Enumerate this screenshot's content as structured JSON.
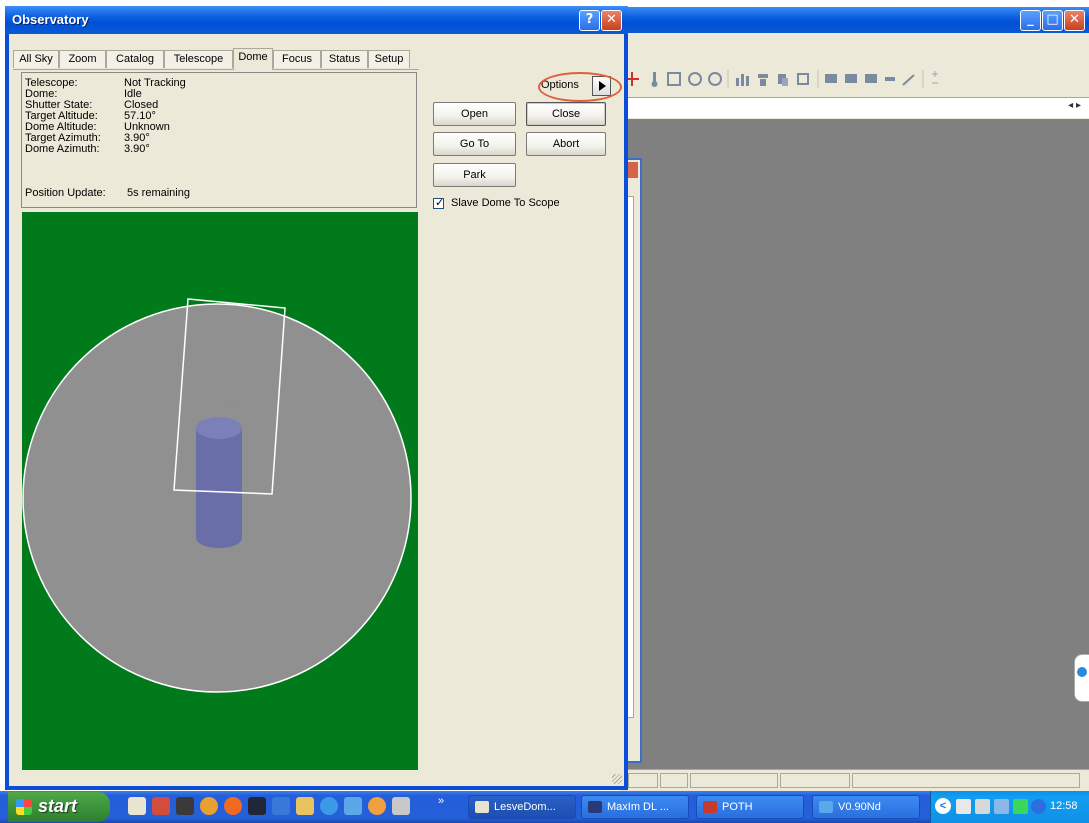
{
  "observatory": {
    "title": "Observatory",
    "help_glyph": "?",
    "close_glyph": "✕",
    "tabs": [
      {
        "label": "All Sky"
      },
      {
        "label": "Zoom"
      },
      {
        "label": "Catalog"
      },
      {
        "label": "Telescope"
      },
      {
        "label": "Dome",
        "active": true
      },
      {
        "label": "Focus"
      },
      {
        "label": "Status"
      },
      {
        "label": "Setup"
      }
    ],
    "info": [
      {
        "label": "Telescope:",
        "value": "Not Tracking"
      },
      {
        "label": "Dome:",
        "value": "Idle"
      },
      {
        "label": "Shutter State:",
        "value": "Closed"
      },
      {
        "label": "Target Altitude:",
        "value": "57.10°"
      },
      {
        "label": "Dome Altitude:",
        "value": "Unknown"
      },
      {
        "label": "Target Azimuth:",
        "value": "3.90°"
      },
      {
        "label": "Dome Azimuth:",
        "value": "3.90°"
      }
    ],
    "position_update": {
      "label": "Position Update:",
      "value": "5s remaining"
    },
    "options_label": "Options",
    "buttons": {
      "open": "Open",
      "close": "Close",
      "goto": "Go To",
      "abort": "Abort",
      "park": "Park"
    },
    "slave": {
      "label": "Slave Dome To Scope",
      "checked": true,
      "check_glyph": "✓"
    },
    "colors": {
      "view_bg": "#007a1a",
      "dome": "#909090",
      "scope": "#6a6ea8",
      "highlight": "#e0603a"
    }
  },
  "background_app": {
    "minimize_glyph": "_",
    "maximize_glyph": "□",
    "close_glyph": "✕",
    "scroll_arrows": "◂ ▸"
  },
  "taskbar": {
    "start_label": "start",
    "more_glyph": "»",
    "tasks": [
      {
        "label": "LesveDom..."
      },
      {
        "label": "MaxIm DL ..."
      },
      {
        "label": "POTH"
      },
      {
        "label": "V0.90Nd"
      }
    ],
    "tray_arrow": "<",
    "clock": "12:58"
  }
}
